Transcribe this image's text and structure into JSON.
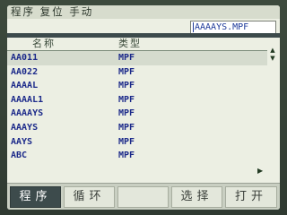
{
  "status_bar": {
    "text": "程序 复位 手动"
  },
  "file_input": {
    "value": "AAAAYS.MPF"
  },
  "columns": {
    "name": "名称",
    "type": "类型"
  },
  "files": [
    {
      "name": "AA011",
      "type": "MPF"
    },
    {
      "name": "AA022",
      "type": "MPF"
    },
    {
      "name": "AAAAL",
      "type": "MPF"
    },
    {
      "name": "AAAAL1",
      "type": "MPF"
    },
    {
      "name": "AAAAYS",
      "type": "MPF"
    },
    {
      "name": "AAAYS",
      "type": "MPF"
    },
    {
      "name": "AAYS",
      "type": "MPF"
    },
    {
      "name": "ABC",
      "type": "MPF"
    }
  ],
  "softkeys": [
    {
      "label": "程序",
      "active": true
    },
    {
      "label": "循环",
      "active": false
    },
    {
      "label": "",
      "active": false
    },
    {
      "label": "选择",
      "active": false
    },
    {
      "label": "打开",
      "active": false
    }
  ],
  "scroll_icons": {
    "up": "triangle-up-icon",
    "down": "triangle-down-icon",
    "more": "triangle-right-icon"
  }
}
